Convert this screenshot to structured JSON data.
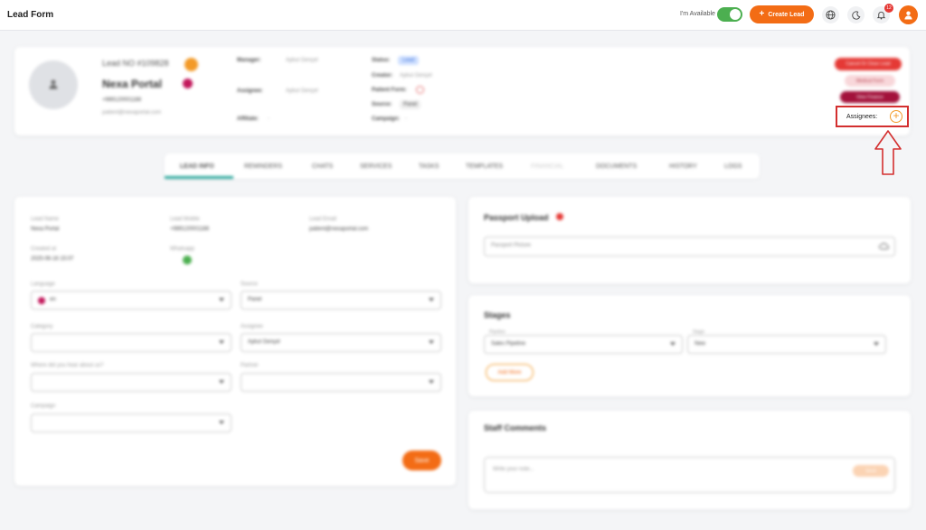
{
  "topbar": {
    "title": "Lead Form",
    "availability_label": "I'm Available",
    "create_lead_label": "Create Lead",
    "notifications_count": "12",
    "colors": {
      "accent": "#f36c15",
      "toggle": "#4caf50",
      "badge": "#e53935"
    }
  },
  "lead": {
    "lead_no": "Lead NO #109828",
    "name": "Nexa Portal",
    "phone": "+989120001188",
    "email": "patient@nexaportal.com",
    "manager_label": "Manager:",
    "manager_value": "Aykut Gençel",
    "assignee_label": "Assignee:",
    "assignee_value": "Aykut Gençel",
    "affiliate_label": "Affiliate:",
    "affiliate_value": "-",
    "status_label": "Status:",
    "status_value": "Lead",
    "creator_label": "Creator:",
    "creator_value": "Aykut Gençel",
    "patient_form_label": "Patient Form:",
    "source_label": "Source:",
    "source_value": "Panel",
    "campaign_label": "Campaign:",
    "campaign_value": "-",
    "cancel_btn": "Cancel Or Close Lead",
    "medical_btn": "Medical Form",
    "finance_btn": "View Finance",
    "assignees_label": "Assignees:"
  },
  "tabs": [
    "LEAD INFO",
    "REMINDERS",
    "CHATS",
    "SERVICES",
    "TASKS",
    "TEMPLATES",
    "FINANCIAL",
    "DOCUMENTS",
    "HISTORY",
    "LOGS"
  ],
  "info": {
    "lead_name_label": "Lead Name",
    "lead_name": "Nexa Portal",
    "lead_mobile_label": "Lead Mobile",
    "lead_mobile": "+989120001188",
    "lead_email_label": "Lead Email",
    "lead_email": "patient@nexaportal.com",
    "created_label": "Created at",
    "created_value": "2025-06-16 15:07",
    "whatsapp_label": "Whatsapp",
    "language_label": "Language",
    "language_value": "en",
    "source_label": "Source",
    "source_value": "Panel",
    "category_label": "Category",
    "assignee_label": "Assignee",
    "assignee_value": "Aykut Gençel",
    "hear_label": "Where did you hear about us?",
    "partner_label": "Partner",
    "campaign_label": "Campaign",
    "save_label": "Save"
  },
  "passport": {
    "title": "Passport Upload",
    "placeholder": "Passport Picture"
  },
  "stages": {
    "title": "Stages",
    "pipeline_label": "Pipeline",
    "pipeline_value": "Sales Pipeline",
    "stage_label": "Stage",
    "stage_value": "New",
    "add_more": "Add More"
  },
  "comments": {
    "title": "Staff Comments",
    "placeholder": "Write your note...",
    "send_label": "Send"
  }
}
